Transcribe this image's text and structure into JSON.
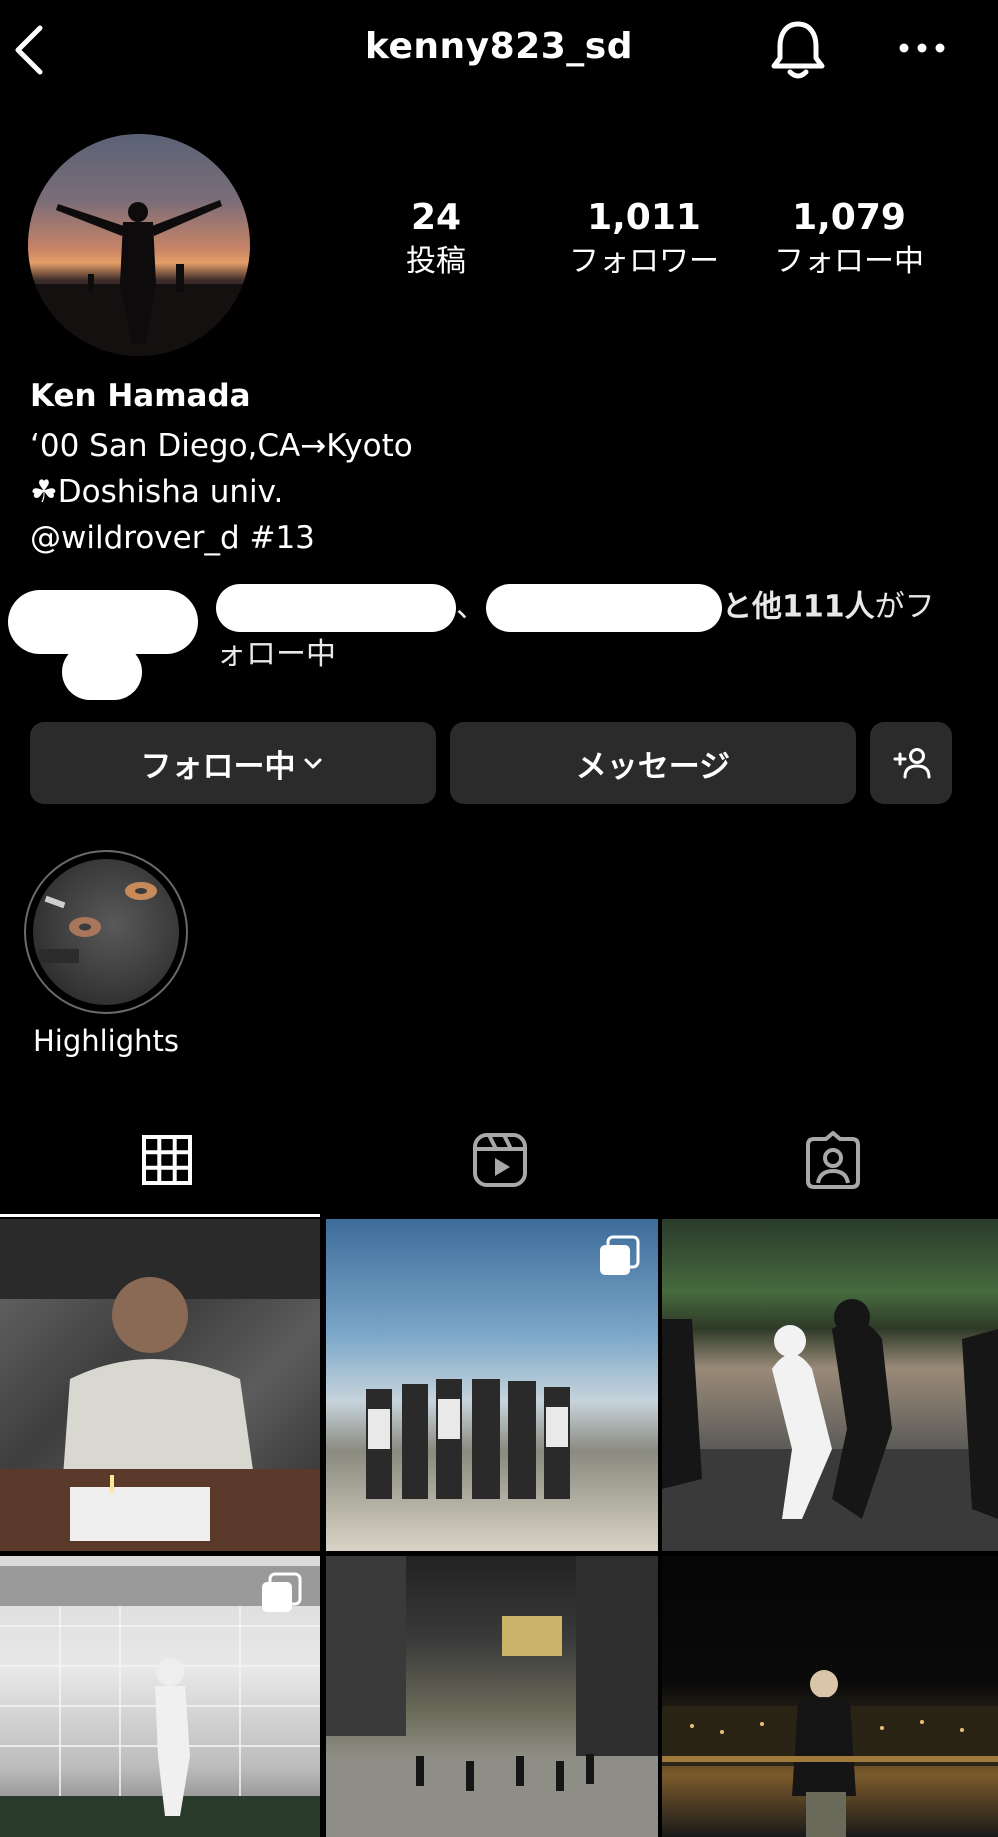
{
  "header": {
    "username": "kenny823_sd",
    "icons": {
      "back": "chevron-left-icon",
      "notify": "bell-icon",
      "more": "more-dots-icon"
    }
  },
  "stats": {
    "posts": {
      "value": "24",
      "label": "投稿"
    },
    "followers": {
      "value": "1,011",
      "label": "フォロワー"
    },
    "following": {
      "value": "1,079",
      "label": "フォロー中"
    }
  },
  "bio": {
    "name": "Ken Hamada",
    "line1": "‘00 San Diego,CA→Kyoto",
    "line2": "☘Doshisha univ.",
    "line3": "@wildrover_d  #13"
  },
  "followed_by": {
    "sep": "、",
    "others": "と他",
    "count": "111人",
    "suffix": "がフォロー中"
  },
  "actions": {
    "following_label": "フォロー中",
    "message_label": "メッセージ"
  },
  "highlights": [
    {
      "label": "Highlights"
    }
  ],
  "tabs": {
    "active": "grid",
    "icons": [
      "grid-icon",
      "reels-icon",
      "tagged-icon"
    ]
  },
  "posts_grid": {
    "count_visible": 6,
    "multi_photo_posts": [
      2,
      4
    ]
  },
  "colors": {
    "background": "#000000",
    "button": "#2b2b2b",
    "text": "#ffffff"
  }
}
